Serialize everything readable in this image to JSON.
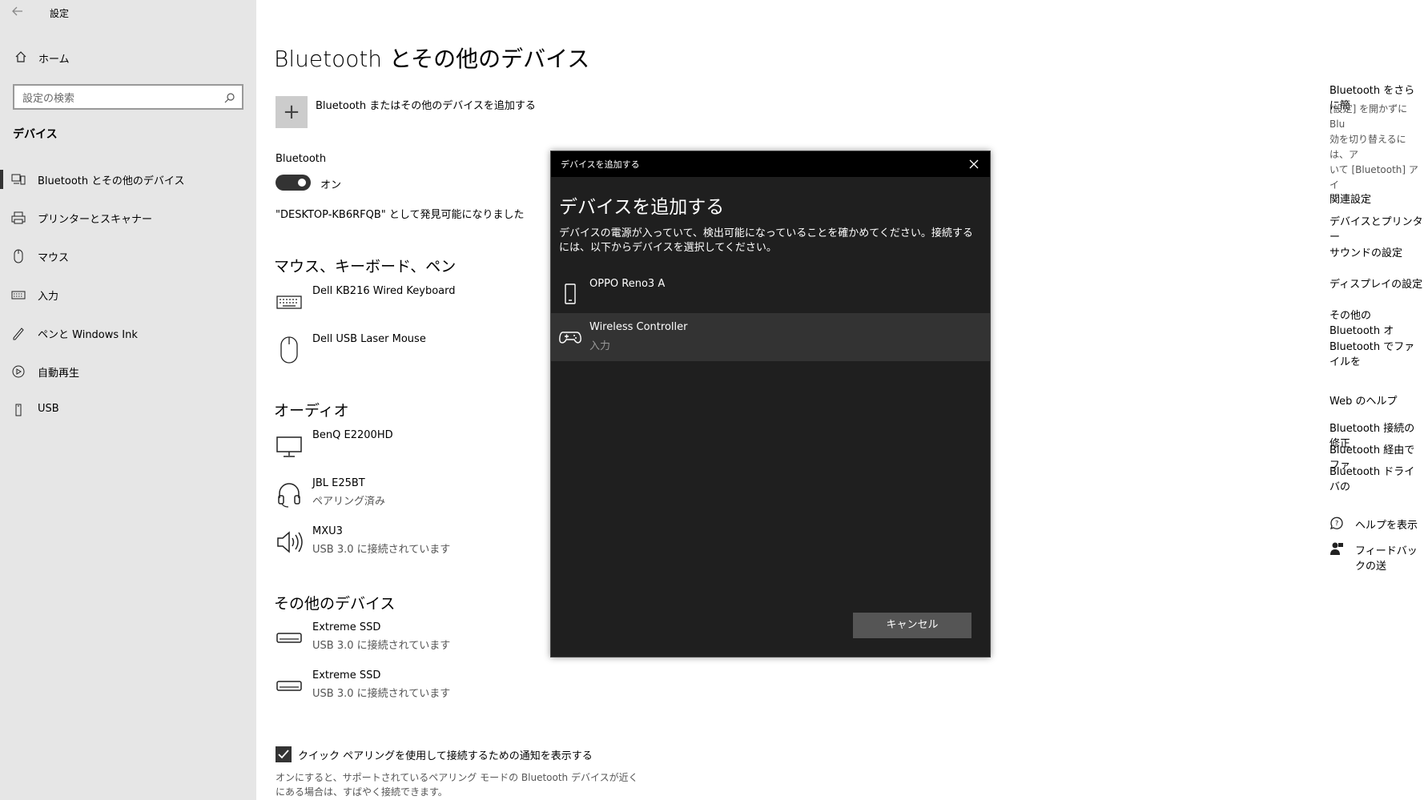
{
  "window": {
    "title": "設定"
  },
  "sidebar": {
    "home": "ホーム",
    "search_placeholder": "設定の検索",
    "section": "デバイス",
    "items": [
      {
        "label": "Bluetooth とその他のデバイス",
        "icon": "bluetooth-devices-icon",
        "selected": true
      },
      {
        "label": "プリンターとスキャナー",
        "icon": "printer-icon"
      },
      {
        "label": "マウス",
        "icon": "mouse-icon"
      },
      {
        "label": "入力",
        "icon": "keyboard-icon"
      },
      {
        "label": "ペンと Windows Ink",
        "icon": "pen-icon"
      },
      {
        "label": "自動再生",
        "icon": "autoplay-icon"
      },
      {
        "label": "USB",
        "icon": "usb-icon"
      }
    ]
  },
  "main": {
    "title": "Bluetooth とその他のデバイス",
    "add_device": "Bluetooth またはその他のデバイスを追加する",
    "bluetooth_label": "Bluetooth",
    "toggle_state": "オン",
    "discoverable": "\"DESKTOP-KB6RFQB\" として発見可能になりました",
    "sections": [
      {
        "title": "マウス、キーボード、ペン",
        "devices": [
          {
            "name": "Dell KB216 Wired Keyboard",
            "status": "",
            "icon": "keyboard-icon"
          },
          {
            "name": "Dell USB Laser Mouse",
            "status": "",
            "icon": "mouse-icon"
          }
        ]
      },
      {
        "title": "オーディオ",
        "devices": [
          {
            "name": "BenQ E2200HD",
            "status": "",
            "icon": "monitor-icon"
          },
          {
            "name": "JBL E25BT",
            "status": "ペアリング済み",
            "icon": "headset-icon"
          },
          {
            "name": "MXU3",
            "status": "USB 3.0 に接続されています",
            "icon": "speaker-icon"
          }
        ]
      },
      {
        "title": "その他のデバイス",
        "devices": [
          {
            "name": "Extreme SSD",
            "status": "USB 3.0 に接続されています",
            "icon": "drive-icon"
          },
          {
            "name": "Extreme SSD",
            "status": "USB 3.0 に接続されています",
            "icon": "drive-icon"
          }
        ]
      }
    ],
    "quick_pair_label": "クイック ペアリングを使用して接続するための通知を表示する",
    "quick_pair_checked": true,
    "quick_pair_desc": "オンにすると、サポートされているペアリング モードの Bluetooth デバイスが近くにある場合は、すばやく接続できます。"
  },
  "right": {
    "more_heading": "Bluetooth をさらに簡",
    "more_text": [
      "[設定] を開かずに Blu",
      "効を切り替えるには、ア",
      "いて [Bluetooth] アイ"
    ],
    "related_heading": "関連設定",
    "related_links": [
      "デバイスとプリンター",
      "サウンドの設定",
      "ディスプレイの設定",
      "その他の Bluetooth オ",
      "Bluetooth でファイルを"
    ],
    "web_heading": "Web のヘルプ",
    "web_links": [
      "Bluetooth 接続の修正",
      "Bluetooth 経由でファ",
      "Bluetooth ドライバの"
    ],
    "help": "ヘルプを表示",
    "feedback": "フィードバックの送"
  },
  "dialog": {
    "title": "デバイスを追加する",
    "heading": "デバイスを追加する",
    "description": "デバイスの電源が入っていて、検出可能になっていることを確かめてください。接続するには、以下からデバイスを選択してください。",
    "devices": [
      {
        "name": "OPPO Reno3 A",
        "status": "",
        "icon": "phone-icon"
      },
      {
        "name": "Wireless Controller",
        "status": "入力",
        "icon": "gamepad-icon",
        "selected": true
      }
    ],
    "cancel": "キャンセル"
  }
}
